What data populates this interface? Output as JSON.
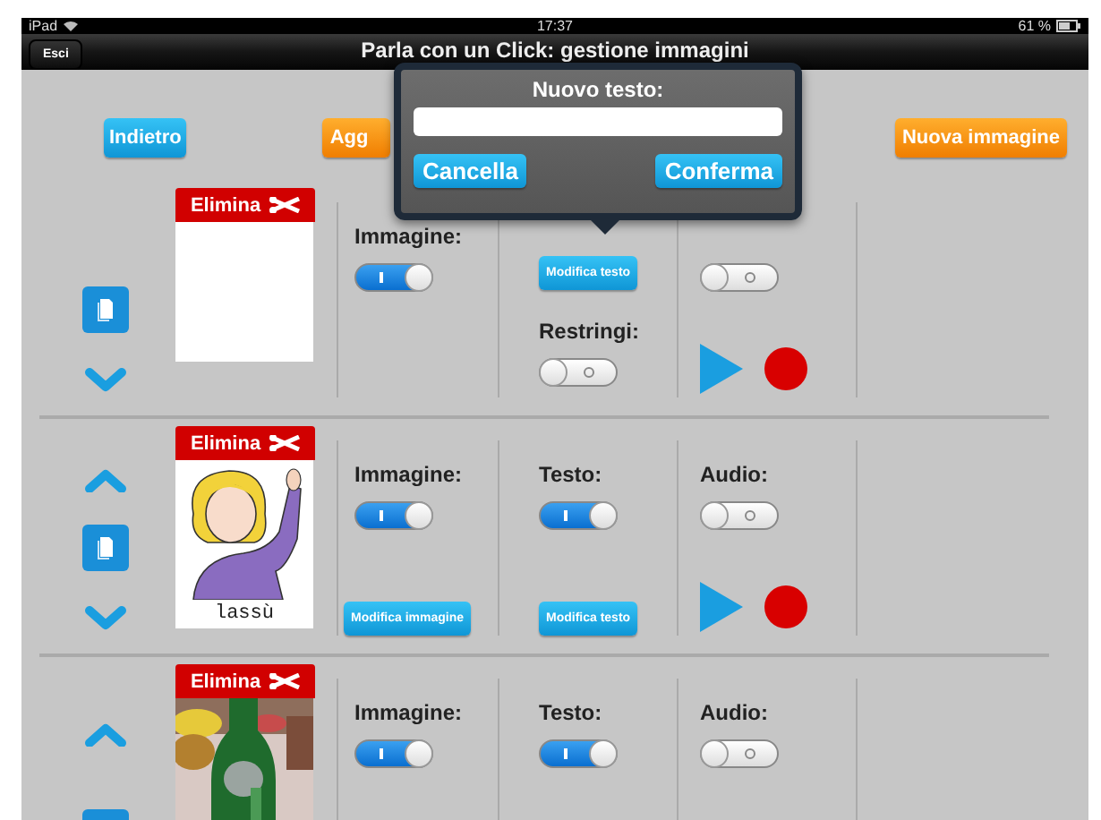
{
  "status_bar": {
    "device": "iPad",
    "time": "17:37",
    "battery": "61 %"
  },
  "nav_bar": {
    "back_button": "Esci",
    "title": "Parla con un Click: gestione immagini"
  },
  "toolbar": {
    "back": "Indietro",
    "add": "Agg",
    "new_image": "Nuova immagine"
  },
  "rows": [
    {
      "move_up": false,
      "move_down": true,
      "delete": "Elimina",
      "kind": "blank",
      "image_label": "Immagine:",
      "image_on": true,
      "text_edit": "Modifica testo",
      "shrink": {
        "label": "Restringi:",
        "on": false
      },
      "audio_on": false,
      "player": true
    },
    {
      "move_up": true,
      "move_down": true,
      "delete": "Elimina",
      "kind": "drawing",
      "caption": "lassù",
      "image_label": "Immagine:",
      "image_on": true,
      "image_edit": "Modifica immagine",
      "text_label": "Testo:",
      "text_on": true,
      "text_edit": "Modifica testo",
      "audio_label": "Audio:",
      "audio_on": false,
      "player": true
    },
    {
      "move_up": true,
      "move_down": false,
      "delete": "Elimina",
      "kind": "picture",
      "image_label": "Immagine:",
      "image_on": true,
      "text_label": "Testo:",
      "text_on": true,
      "audio_label": "Audio:",
      "audio_on": false,
      "player": false
    }
  ],
  "popover": {
    "title": "Nuovo testo:",
    "cancel": "Cancella",
    "confirm": "Conferma"
  }
}
